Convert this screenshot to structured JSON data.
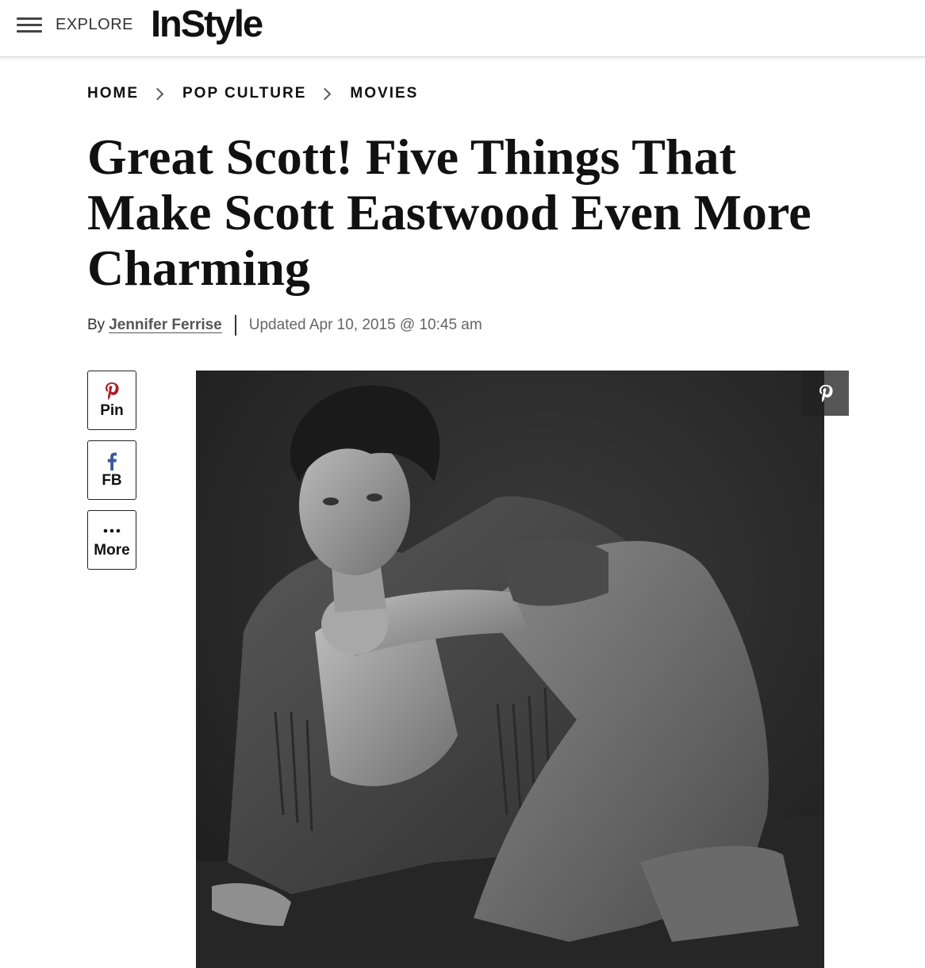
{
  "header": {
    "explore_label": "EXPLORE",
    "logo_text": "InStyle"
  },
  "breadcrumb": {
    "items": [
      "HOME",
      "POP CULTURE",
      "MOVIES"
    ]
  },
  "article": {
    "title": "Great Scott! Five Things That Make Scott Eastwood Even More Charming",
    "by_prefix": "By",
    "author": "Jennifer Ferrise",
    "updated": "Updated Apr 10, 2015 @ 10:45 am"
  },
  "share": {
    "pin_label": "Pin",
    "fb_label": "FB",
    "more_label": "More"
  },
  "colors": {
    "pinterest_red": "#b01d27",
    "facebook_blue": "#3b5998"
  }
}
